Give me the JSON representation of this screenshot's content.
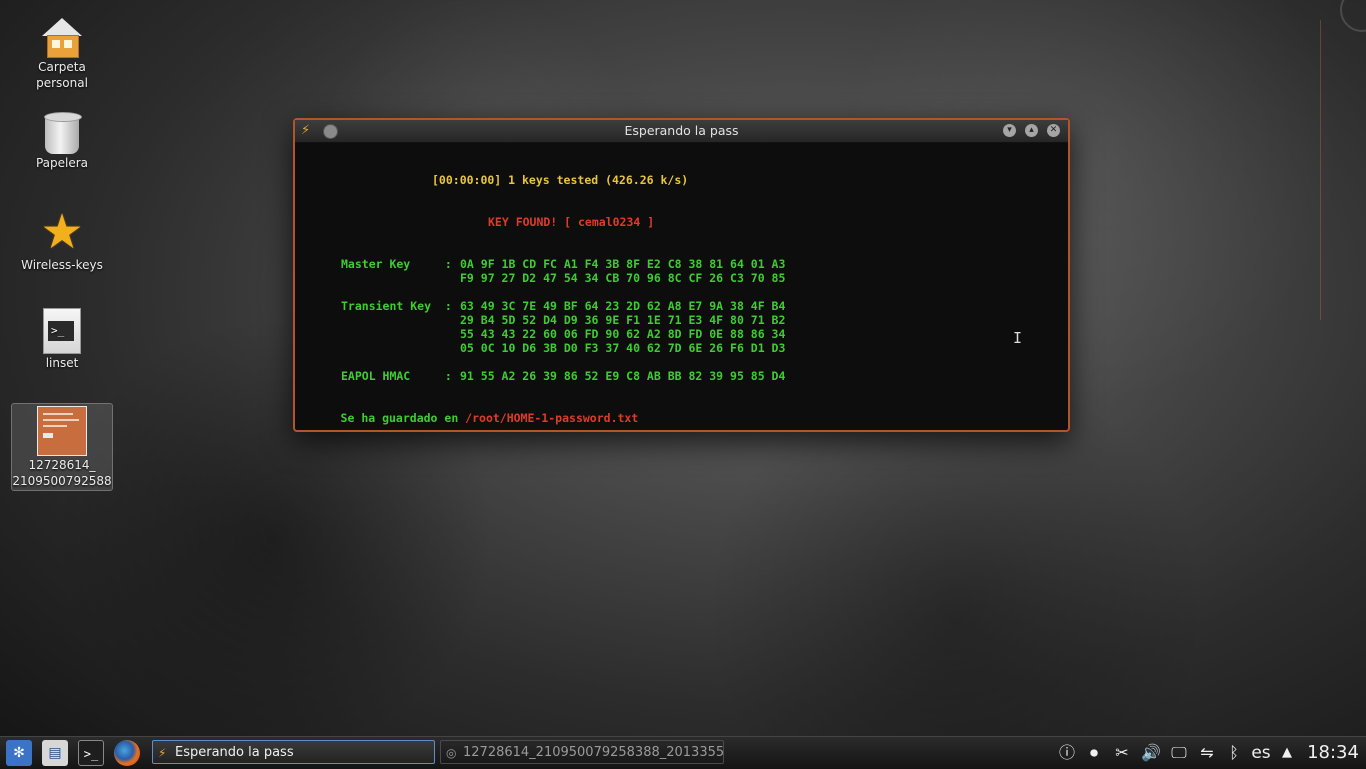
{
  "desktop": {
    "icons": [
      {
        "label_line1": "Carpeta",
        "label_line2": "personal"
      },
      {
        "label_line1": "Papelera"
      },
      {
        "label_line1": "Wireless-keys"
      },
      {
        "label_line1": "linset"
      },
      {
        "label_line1": "12728614_",
        "label_line2": "2109500792588"
      }
    ]
  },
  "window": {
    "title": "Esperando la pass",
    "terminal": {
      "progress": "[00:00:00] 1 keys tested (426.26 k/s)",
      "key_found": "KEY FOUND! [ cemal0234 ]",
      "master_label": "Master Key     :",
      "master_1": "0A 9F 1B CD FC A1 F4 3B 8F E2 C8 38 81 64 01 A3",
      "master_2": "F9 97 27 D2 47 54 34 CB 70 96 8C CF 26 C3 70 85",
      "transient_label": "Transient Key  :",
      "transient_1": "63 49 3C 7E 49 BF 64 23 2D 62 A8 E7 9A 38 4F B4",
      "transient_2": "29 B4 5D 52 D4 D9 36 9E F1 1E 71 E3 4F 80 71 B2",
      "transient_3": "55 43 43 22 60 06 FD 90 62 A2 8D FD 0E 88 86 34",
      "transient_4": "05 0C 10 D6 3B D0 F3 37 40 62 7D 6E 26 F6 D1 D3",
      "eapol_label": "EAPOL HMAC     :",
      "eapol_1": "91 55 A2 26 39 86 52 E9 C8 AB BB 82 39 95 85 D4",
      "saved_prefix": "Se ha guardado en ",
      "saved_path": "/root/HOME-1-password.txt"
    }
  },
  "taskbar": {
    "tasks": [
      {
        "label": "Esperando la pass"
      },
      {
        "label": "12728614_210950079258388_2013355"
      }
    ],
    "keyboard_layout": "es",
    "clock": "18:34"
  }
}
